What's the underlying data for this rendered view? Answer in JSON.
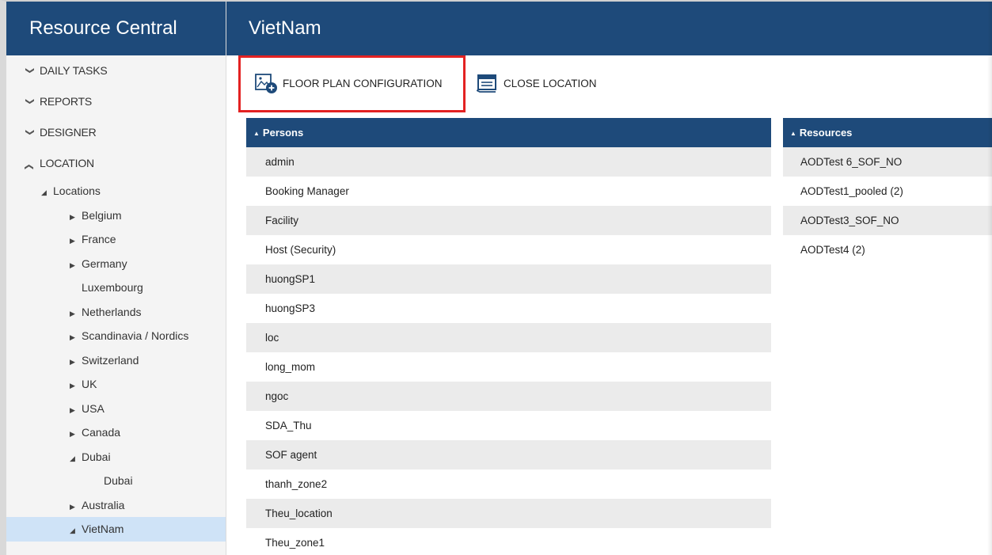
{
  "app": {
    "title": "Resource Central"
  },
  "page": {
    "title": "VietNam"
  },
  "sidebar": {
    "sections": [
      {
        "label": "DAILY TASKS",
        "expanded": false
      },
      {
        "label": "REPORTS",
        "expanded": false
      },
      {
        "label": "DESIGNER",
        "expanded": false
      },
      {
        "label": "LOCATION",
        "expanded": true
      }
    ],
    "tree": {
      "root": "Locations",
      "items": [
        {
          "label": "Belgium",
          "expandable": true,
          "expanded": false
        },
        {
          "label": "France",
          "expandable": true,
          "expanded": false
        },
        {
          "label": "Germany",
          "expandable": true,
          "expanded": false
        },
        {
          "label": "Luxembourg",
          "expandable": false
        },
        {
          "label": "Netherlands",
          "expandable": true,
          "expanded": false
        },
        {
          "label": "Scandinavia / Nordics",
          "expandable": true,
          "expanded": false
        },
        {
          "label": "Switzerland",
          "expandable": true,
          "expanded": false
        },
        {
          "label": "UK",
          "expandable": true,
          "expanded": false
        },
        {
          "label": "USA",
          "expandable": true,
          "expanded": false
        },
        {
          "label": "Canada",
          "expandable": true,
          "expanded": false
        },
        {
          "label": "Dubai",
          "expandable": true,
          "expanded": true,
          "children": [
            "Dubai"
          ]
        },
        {
          "label": "Australia",
          "expandable": true,
          "expanded": false
        },
        {
          "label": "VietNam",
          "expandable": true,
          "expanded": true,
          "selected": true
        }
      ]
    }
  },
  "toolbar": {
    "floor_plan_label": "FLOOR PLAN CONFIGURATION",
    "close_location_label": "CLOSE LOCATION"
  },
  "persons": {
    "header": "Persons",
    "rows": [
      "admin",
      "Booking Manager",
      "Facility",
      "Host (Security)",
      "huongSP1",
      "huongSP3",
      "loc",
      "long_mom",
      "ngoc",
      "SDA_Thu",
      "SOF agent",
      "thanh_zone2",
      "Theu_location",
      "Theu_zone1"
    ]
  },
  "resources": {
    "header": "Resources",
    "rows": [
      "AODTest 6_SOF_NO",
      "AODTest1_pooled (2)",
      "AODTest3_SOF_NO",
      "AODTest4 (2)"
    ]
  },
  "colors": {
    "header_bg": "#1e4a7a",
    "selected_bg": "#cfe3f7",
    "highlight": "#e32222",
    "row_alt": "#ebebeb"
  }
}
